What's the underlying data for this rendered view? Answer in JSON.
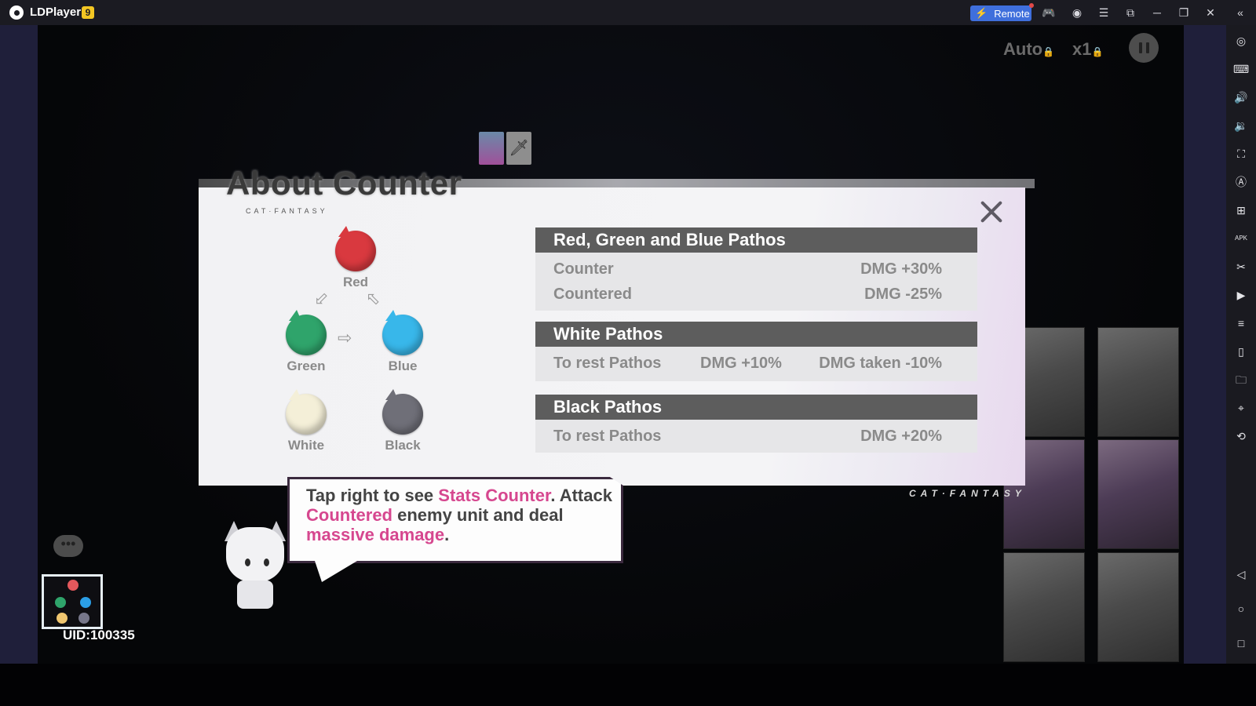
{
  "titlebar": {
    "app_name": "LDPlayer",
    "version": "9",
    "remote_label": "Remote",
    "icons": [
      "gamepad-icon",
      "account-icon",
      "menu-icon",
      "screen-resize-icon",
      "minimize-icon",
      "restore-icon",
      "close-icon",
      "collapse-sidebar-icon"
    ]
  },
  "sidebar": {
    "icons": [
      "settings-icon",
      "keyboard-icon",
      "volume-up-icon",
      "volume-down-icon",
      "screenshot-icon",
      "auto-click-icon",
      "add-app-icon",
      "apk-install-icon",
      "scissors-icon",
      "record-icon",
      "operation-record-icon",
      "shake-icon",
      "folder-icon",
      "location-icon",
      "rotate-icon"
    ],
    "nav": [
      "back-icon",
      "home-icon",
      "recents-icon"
    ],
    "glyphs": [
      "◎",
      "⌨",
      "🔊",
      "🔉",
      "⛶",
      "Ⓐ",
      "⊞",
      "APK",
      "✂",
      "▶",
      "≡",
      "▯",
      "🗀",
      "⌖",
      "⟲"
    ],
    "nav_glyphs": [
      "◁",
      "○",
      "□"
    ]
  },
  "hud": {
    "auto_label": "Auto",
    "speed_label": "x1"
  },
  "dialog": {
    "title": "About Counter",
    "subtitle": "CAT·FANTASY",
    "diagram": {
      "red": {
        "label": "Red",
        "color": "#d9393f"
      },
      "green": {
        "label": "Green",
        "color": "#2fa46b"
      },
      "blue": {
        "label": "Blue",
        "color": "#38b7ea"
      },
      "white": {
        "label": "White",
        "color": "#f4efd8"
      },
      "black": {
        "label": "Black",
        "color": "#6f6f78"
      }
    },
    "sections": [
      {
        "title": "Red, Green and Blue Pathos",
        "rows": [
          {
            "label": "Counter",
            "values": [
              "DMG +30%"
            ]
          },
          {
            "label": "Countered",
            "values": [
              "DMG -25%"
            ]
          }
        ]
      },
      {
        "title": "White Pathos",
        "rows": [
          {
            "label": "To rest Pathos",
            "values": [
              "DMG +10%",
              "DMG taken -10%"
            ]
          }
        ]
      },
      {
        "title": "Black Pathos",
        "rows": [
          {
            "label": "To rest Pathos",
            "values": [
              "DMG +20%"
            ]
          }
        ]
      }
    ]
  },
  "tutorial": {
    "parts": [
      {
        "text": "Tap right to see ",
        "hl": false
      },
      {
        "text": "Stats Counter",
        "hl": true
      },
      {
        "text": ". Attack ",
        "hl": false
      },
      {
        "text": "Countered",
        "hl": true
      },
      {
        "text": " enemy unit and deal ",
        "hl": false
      },
      {
        "text": "massive damage",
        "hl": true
      },
      {
        "text": ".",
        "hl": false
      }
    ],
    "highlight_color": "#d6478f"
  },
  "footer": {
    "uid": "UID:100335",
    "brand": "CAT·FANTASY"
  }
}
